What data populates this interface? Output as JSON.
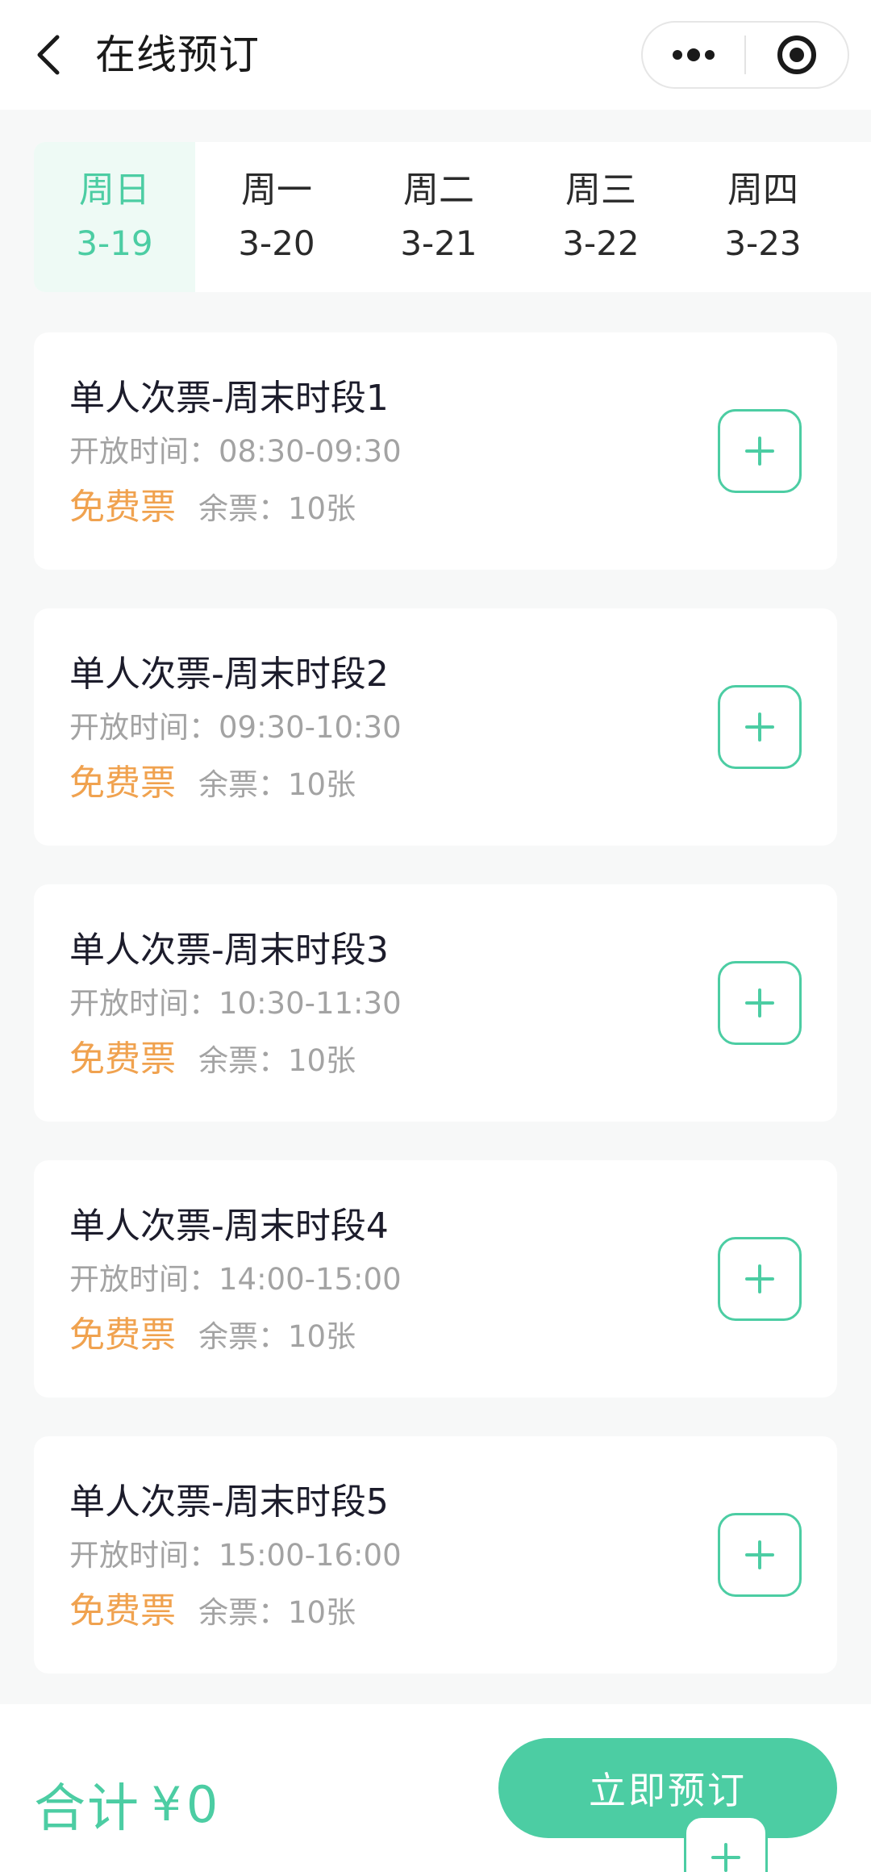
{
  "header": {
    "title": "在线预订",
    "back_icon": "chevron-left-icon",
    "more_icon": "more-dots-icon",
    "close_icon": "target-circle-icon"
  },
  "dates": [
    {
      "weekday": "周日",
      "day": "3-19",
      "selected": true
    },
    {
      "weekday": "周一",
      "day": "3-20",
      "selected": false
    },
    {
      "weekday": "周二",
      "day": "3-21",
      "selected": false
    },
    {
      "weekday": "周三",
      "day": "3-22",
      "selected": false
    },
    {
      "weekday": "周四",
      "day": "3-23",
      "selected": false
    }
  ],
  "tickets": [
    {
      "name": "单人次票-周末时段1",
      "time": "开放时间：08:30-09:30",
      "type": "免费票",
      "stock": "余票：10张"
    },
    {
      "name": "单人次票-周末时段2",
      "time": "开放时间：09:30-10:30",
      "type": "免费票",
      "stock": "余票：10张"
    },
    {
      "name": "单人次票-周末时段3",
      "time": "开放时间：10:30-11:30",
      "type": "免费票",
      "stock": "余票：10张"
    },
    {
      "name": "单人次票-周末时段4",
      "time": "开放时间：14:00-15:00",
      "type": "免费票",
      "stock": "余票：10张"
    },
    {
      "name": "单人次票-周末时段5",
      "time": "开放时间：15:00-16:00",
      "type": "免费票",
      "stock": "余票：10张"
    }
  ],
  "footer": {
    "total_label": "合计",
    "currency": "¥",
    "total_amount": "0",
    "book_label": "立即预订"
  },
  "colors": {
    "accent": "#4ccda3",
    "accent_light": "#eefaf5",
    "free_ticket": "#f0a24f",
    "muted_text": "#a3a3a3",
    "page_bg": "#f7f8f8"
  }
}
